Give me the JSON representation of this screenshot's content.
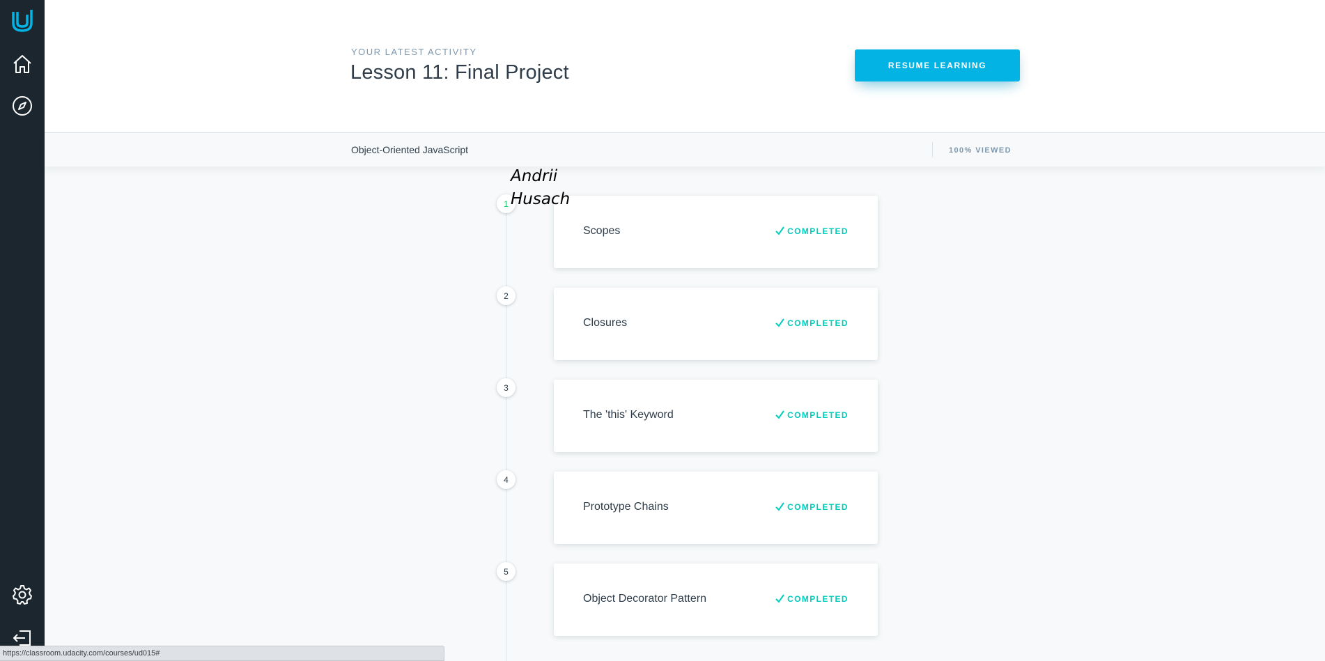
{
  "header": {
    "eyebrow": "YOUR LATEST ACTIVITY",
    "title": "Lesson 11: Final Project",
    "resume_label": "RESUME LEARNING"
  },
  "course_bar": {
    "course_name": "Object-Oriented JavaScript",
    "viewed": "100% VIEWED"
  },
  "signature": "Andrii Husach",
  "lessons": [
    {
      "number": "1",
      "title": "Scopes",
      "status": "COMPLETED"
    },
    {
      "number": "2",
      "title": "Closures",
      "status": "COMPLETED"
    },
    {
      "number": "3",
      "title": "The 'this' Keyword",
      "status": "COMPLETED"
    },
    {
      "number": "4",
      "title": "Prototype Chains",
      "status": "COMPLETED"
    },
    {
      "number": "5",
      "title": "Object Decorator Pattern",
      "status": "COMPLETED"
    }
  ],
  "status_bar": {
    "url": "https://classroom.udacity.com/courses/ud015#"
  },
  "colors": {
    "sidebar": "#1c262f",
    "accent": "#02b3e4",
    "completed": "#02ccba"
  },
  "icons": {
    "sidebar": [
      "udacity-logo-icon",
      "home-icon",
      "compass-icon",
      "settings-icon",
      "logout-icon"
    ],
    "status": "check-icon"
  }
}
